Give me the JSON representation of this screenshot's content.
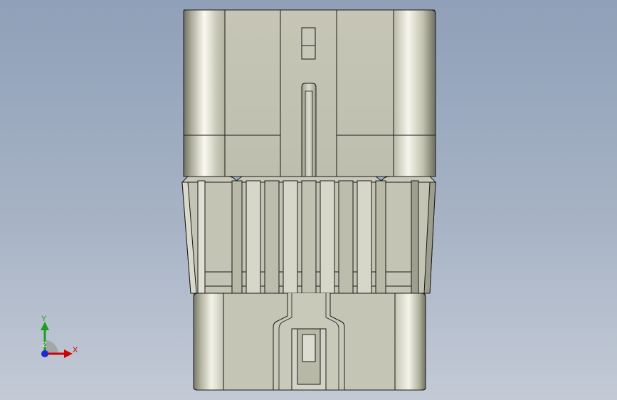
{
  "viewport": {
    "background_top": "#8fa0b8",
    "background_bottom": "#c3cad6"
  },
  "model": {
    "name": "connector-housing",
    "body_color": "#c3c3b2",
    "highlight_color": "#f2f2ea",
    "edge_color": "#1a1a1a"
  },
  "triad": {
    "x_label": "X",
    "y_label": "Y",
    "z_label": "Z",
    "x_color": "#d40000",
    "y_color": "#1aa01a",
    "z_color": "#1a2ad4"
  }
}
